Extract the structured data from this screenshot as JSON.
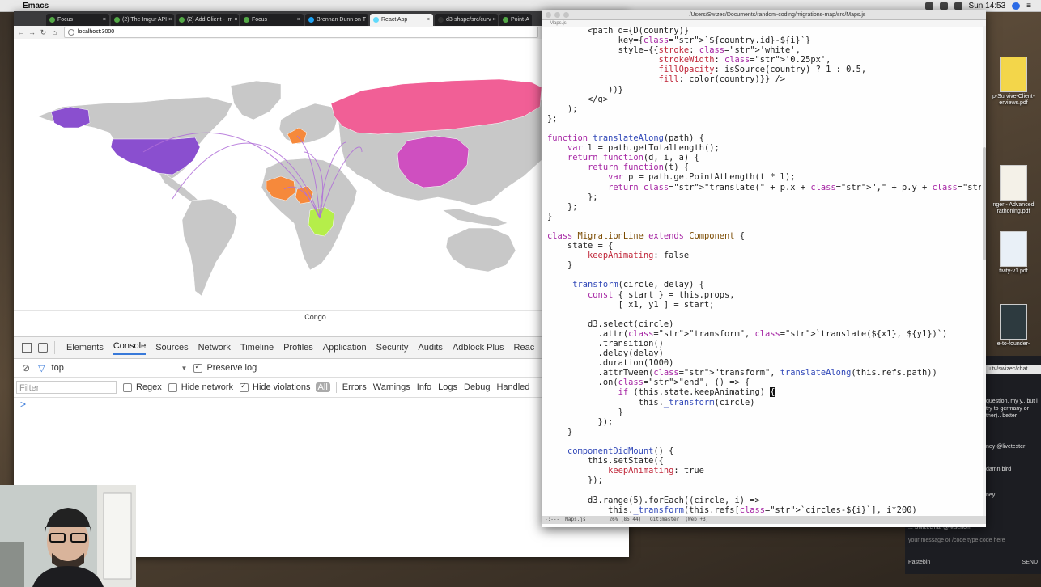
{
  "menubar": {
    "app_name": "Emacs",
    "clock": "Sun 14:53"
  },
  "browser": {
    "tabs": [
      {
        "title": "Focus"
      },
      {
        "title": "(2) The Imgur API"
      },
      {
        "title": "(2) Add Client - Im"
      },
      {
        "title": "Focus"
      },
      {
        "title": "Brennan Dunn on T"
      },
      {
        "title": "React App"
      },
      {
        "title": "d3-shape/src/curv"
      },
      {
        "title": "Point-A"
      }
    ],
    "active_tab_index": 5,
    "tab_close": "×",
    "url": "localhost:3000",
    "map_caption": "Congo",
    "map_colors": {
      "land": "#c8c8c8",
      "usa": "#8a4fcf",
      "russia": "#f15f96",
      "china": "#cf4fc0",
      "congo": "#b5ee4a",
      "west_africa": "#f6893b",
      "lines": "#b06fd8"
    }
  },
  "devtools": {
    "tabs": [
      "Elements",
      "Console",
      "Sources",
      "Network",
      "Timeline",
      "Profiles",
      "Application",
      "Security",
      "Audits",
      "Adblock Plus",
      "Reac"
    ],
    "active_tab": "Console",
    "context": "top",
    "preserve_log_label": "Preserve log",
    "preserve_log_checked": true,
    "filter_placeholder": "Filter",
    "regex_label": "Regex",
    "hide_network_label": "Hide network",
    "hide_violations_label": "Hide violations",
    "hide_violations_checked": true,
    "levels": [
      "All",
      "Errors",
      "Warnings",
      "Info",
      "Logs",
      "Debug",
      "Handled"
    ],
    "prompt_symbol": ">"
  },
  "emacs": {
    "title_path": "/Users/Swizec/Documents/random-coding/migrations-map/src/Maps.js",
    "tab_label": "Maps.js",
    "modeline": "-:---  Maps.js        26% (85,44)   Git:master  (Web +3)",
    "code_lines": [
      "        <path d={D(country)}",
      "              key={`${country.id}-${i}`}",
      "              style={{stroke: 'white',",
      "                      strokeWidth: '0.25px',",
      "                      fillOpacity: isSource(country) ? 1 : 0.5,",
      "                      fill: color(country)}} />",
      "            ))}",
      "        </g>",
      "    );",
      "};",
      "",
      "function translateAlong(path) {",
      "    var l = path.getTotalLength();",
      "    return function(d, i, a) {",
      "        return function(t) {",
      "            var p = path.getPointAtLength(t * l);",
      "            return \"translate(\" + p.x + \",\" + p.y + \")\";",
      "        };",
      "    };",
      "}",
      "",
      "class MigrationLine extends Component {",
      "    state = {",
      "        keepAnimating: false",
      "    }",
      "",
      "    _transform(circle, delay) {",
      "        const { start } = this.props,",
      "              [ x1, y1 ] = start;",
      "",
      "        d3.select(circle)",
      "          .attr(\"transform\", `translate(${x1}, ${y1})`)",
      "          .transition()",
      "          .delay(delay)",
      "          .duration(1000)",
      "          .attrTween(\"transform\", translateAlong(this.refs.path))",
      "          .on(\"end\", () => {",
      "              if (this.state.keepAnimating) {",
      "                  this._transform(circle)",
      "              }",
      "          });",
      "    }",
      "",
      "    componentDidMount() {",
      "        this.setState({",
      "            keepAnimating: true",
      "        });",
      "",
      "        d3.range(5).forEach((circle, i) =>",
      "            this._transform(this.refs[`circles-${i}`], i*200)"
    ]
  },
  "desktop": {
    "files": [
      {
        "label": "p-Survive-Client-\nerviews.pdf"
      },
      {
        "label": "nger - Advanced\nrathoning.pdf"
      },
      {
        "label": "tivity-v1.pdf"
      },
      {
        "label": "e-to-founder-"
      }
    ]
  },
  "chat": {
    "url": "u.tv/swizec/chat",
    "messages": [
      "question, my\ny.. but i try to\ngermany or\nther).. better",
      "ney @livetester",
      "damn bird",
      "ney"
    ],
    "last_line": "... Swizec  hai @wisehom",
    "input_placeholder": "your message or /code type code here",
    "pastebin_label": "Pastebin",
    "send_label": "SEND"
  }
}
